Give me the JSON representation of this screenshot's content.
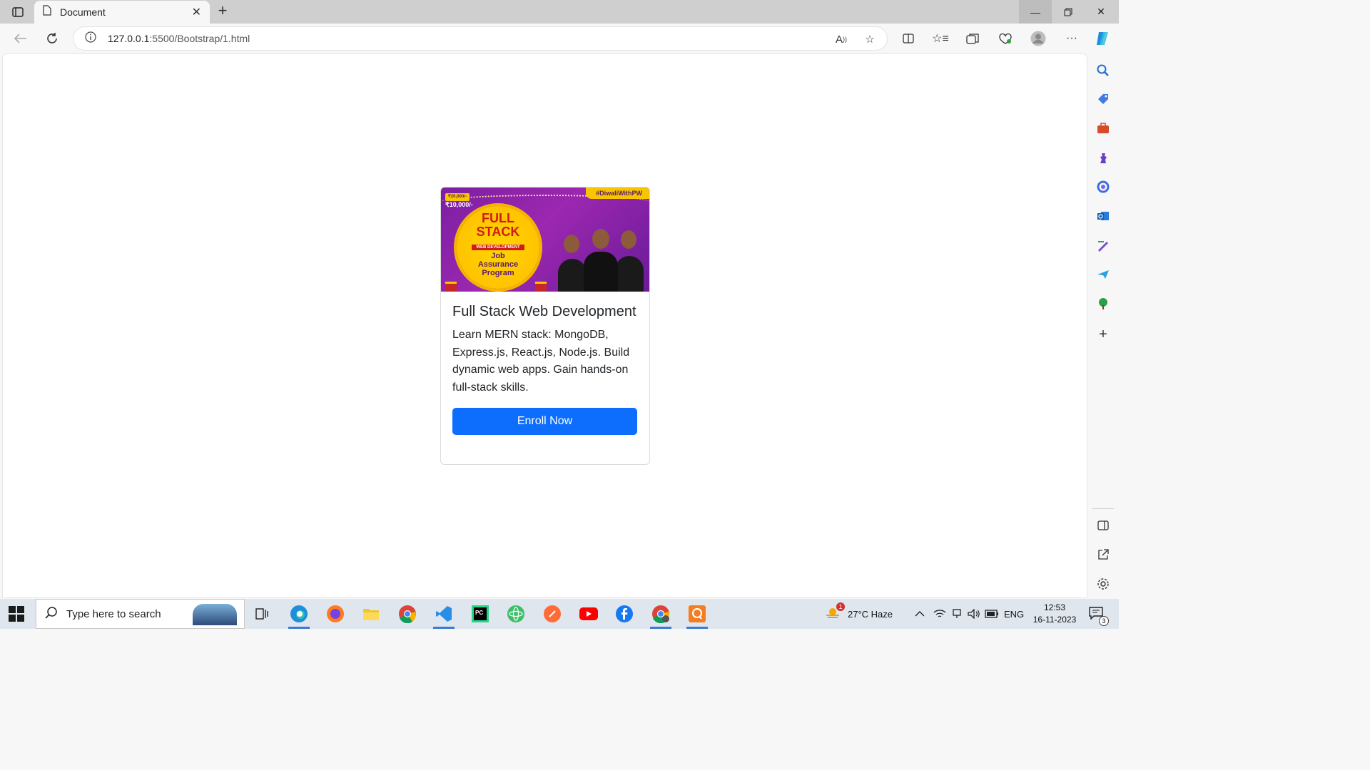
{
  "browser": {
    "tab_title": "Document",
    "url_host": "127.0.0.1",
    "url_path": ":5500/Bootstrap/1.html"
  },
  "card": {
    "banner": {
      "hashtag": "#DiwaliWithPW",
      "old_price": "₹20,000/-",
      "price": "₹10,000/-",
      "badge_line1": "FULL",
      "badge_line2": "STACK",
      "badge_subtitle": "WEB DEVELOPMENT",
      "badge_line3": "Job",
      "badge_line4": "Assurance",
      "badge_line5": "Program"
    },
    "title": "Full Stack Web Development",
    "text": "Learn MERN stack: MongoDB, Express.js, React.js, Node.js. Build dynamic web apps. Gain hands-on full-stack skills.",
    "button_label": "Enroll Now"
  },
  "taskbar": {
    "search_placeholder": "Type here to search",
    "weather": "27°C Haze",
    "weather_badge": "1",
    "language": "ENG",
    "time": "12:53",
    "date": "16-11-2023",
    "notification_count": "3"
  },
  "colors": {
    "primary_button": "#0d6efd",
    "banner_purple": "#9c27b0",
    "banner_yellow": "#f7c600"
  }
}
